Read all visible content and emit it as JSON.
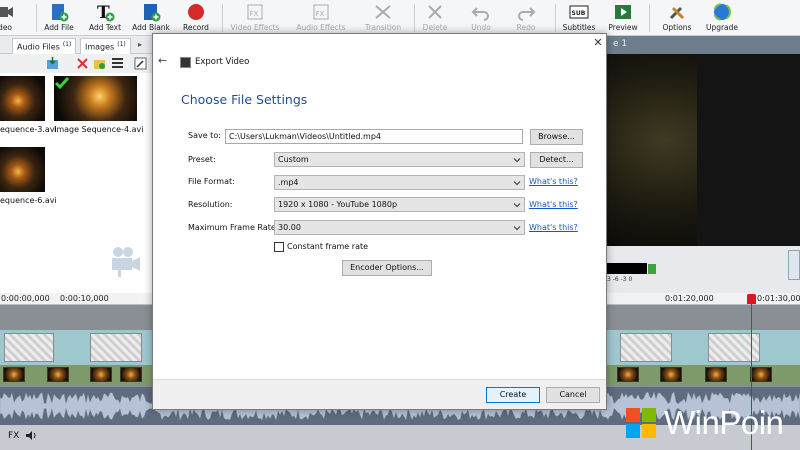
{
  "toolbar": {
    "items": [
      {
        "label": "ideo",
        "icon": "video-icon",
        "enabled": true
      },
      {
        "label": "Add File",
        "icon": "add-file-icon",
        "enabled": true
      },
      {
        "label": "Add Text",
        "icon": "add-text-icon",
        "enabled": true
      },
      {
        "label": "Add Blank",
        "icon": "add-blank-icon",
        "enabled": true
      },
      {
        "label": "Record",
        "icon": "record-icon",
        "enabled": true
      },
      {
        "label": "Video Effects",
        "icon": "video-effects-icon",
        "enabled": false
      },
      {
        "label": "Audio Effects",
        "icon": "audio-effects-icon",
        "enabled": false
      },
      {
        "label": "Transition",
        "icon": "transition-icon",
        "enabled": false
      },
      {
        "label": "Delete",
        "icon": "delete-icon",
        "enabled": false
      },
      {
        "label": "Undo",
        "icon": "undo-icon",
        "enabled": false
      },
      {
        "label": "Redo",
        "icon": "redo-icon",
        "enabled": false
      },
      {
        "label": "Subtitles",
        "icon": "subtitles-icon",
        "enabled": true
      },
      {
        "label": "Preview",
        "icon": "preview-icon",
        "enabled": true
      },
      {
        "label": "Options",
        "icon": "options-icon",
        "enabled": true
      },
      {
        "label": "Upgrade",
        "icon": "upgrade-icon",
        "enabled": true
      }
    ],
    "sub_badge": "SUB",
    "fx_badge": "FX"
  },
  "bin_tabs": [
    {
      "label": "Audio Files",
      "count": "(1)"
    },
    {
      "label": "Images",
      "count": "(1)"
    }
  ],
  "bin_items": [
    {
      "label": "equence-3.avi"
    },
    {
      "label": "Image Sequence-4.avi"
    },
    {
      "label": "equence-6.avi"
    }
  ],
  "preview": {
    "title": "e 1"
  },
  "meter_ticks": "3  -6  -3  0",
  "timeline": {
    "ruler": [
      "0:00:00,000",
      "0:00:10,000",
      "0:01:20,000",
      "0:01:30,000"
    ],
    "fx_label": "FX"
  },
  "watermark": "WinPoin",
  "dialog": {
    "title": "Export Video",
    "heading": "Choose File Settings",
    "save_to_label": "Save to:",
    "save_to_value": "C:\\Users\\Lukman\\Videos\\Untitled.mp4",
    "browse_label": "Browse...",
    "preset_label": "Preset:",
    "preset_value": "Custom",
    "detect_label": "Detect...",
    "format_label": "File Format:",
    "format_value": ".mp4",
    "resolution_label": "Resolution:",
    "resolution_value": "1920 x 1080 - YouTube 1080p",
    "framerate_label": "Maximum Frame Rate:",
    "framerate_value": "30.00",
    "whats_this": "What's this?",
    "constant_fr_label": "Constant frame rate",
    "constant_fr_checked": false,
    "encoder_label": "Encoder Options...",
    "create_label": "Create",
    "cancel_label": "Cancel",
    "close_glyph": "✕",
    "back_glyph": "←"
  }
}
